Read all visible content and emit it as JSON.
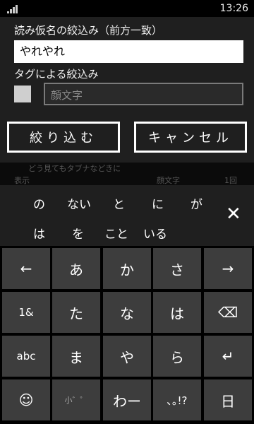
{
  "status": {
    "time": "13:26"
  },
  "dialog": {
    "kana_label": "読み仮名の絞込み（前方一致）",
    "kana_value": "やれやれ",
    "tag_label": "タグによる絞込み",
    "tag_placeholder": "顔文字",
    "apply_label": "絞り込む",
    "cancel_label": "キャンセル"
  },
  "background_list": {
    "line1": "どう見てもタブナなどきに",
    "left": "表示",
    "mid": "顔文字",
    "right": "1回"
  },
  "suggestions": {
    "row1": [
      "の",
      "ない",
      "と",
      "に",
      "が"
    ],
    "row2": [
      "は",
      "を",
      "こと",
      "いる"
    ],
    "close_icon": "close-icon"
  },
  "keyboard": {
    "row1": [
      "←",
      "あ",
      "か",
      "さ",
      "→"
    ],
    "row2": [
      "1&",
      "た",
      "な",
      "は",
      "⌫"
    ],
    "row3": [
      "abc",
      "ま",
      "や",
      "ら",
      "↵"
    ],
    "row4": [
      "☺",
      "小゛゜",
      "わー",
      "､｡!?",
      "日"
    ]
  }
}
